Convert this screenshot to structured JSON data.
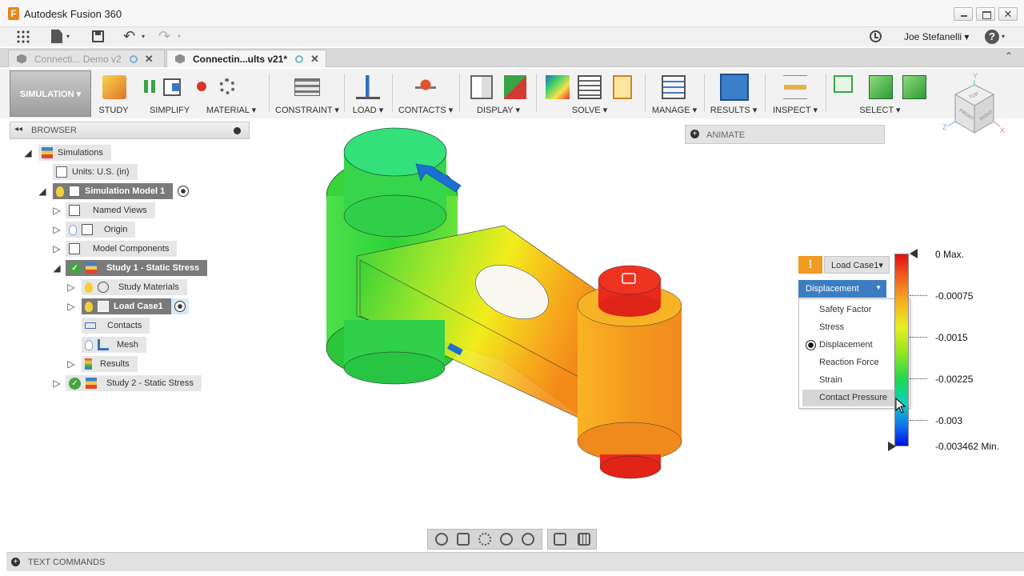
{
  "window": {
    "app_title": "Autodesk Fusion 360",
    "logo_letter": "F",
    "close_glyph": "✕"
  },
  "quick_access": {
    "user_name": "Joe Stefanelli ▾",
    "help_label": "?",
    "undo_glyph": "↶",
    "redo_glyph": "↷",
    "caret": "▾"
  },
  "tabs": [
    {
      "label": "Connecti... Demo v2",
      "active": false
    },
    {
      "label": "Connectin...ults v21*",
      "active": true
    }
  ],
  "tab_close_glyph": "✕",
  "tab_expand_glyph": "⌃",
  "ribbon": {
    "workspace": "SIMULATION ▾",
    "groups": [
      {
        "label": "STUDY"
      },
      {
        "label": "SIMPLIFY"
      },
      {
        "label": "MATERIAL ▾"
      },
      {
        "label": "CONSTRAINT ▾"
      },
      {
        "label": "LOAD ▾"
      },
      {
        "label": "CONTACTS ▾"
      },
      {
        "label": "DISPLAY ▾"
      },
      {
        "label": "SOLVE ▾"
      },
      {
        "label": "MANAGE ▾"
      },
      {
        "label": "RESULTS ▾"
      },
      {
        "label": "INSPECT ▾"
      },
      {
        "label": "SELECT ▾"
      }
    ]
  },
  "browser": {
    "title": "BROWSER",
    "collapse_glyph": "◂◂",
    "items": [
      {
        "label": "Simulations"
      },
      {
        "label": "Units: U.S. (in)"
      },
      {
        "label": "Simulation Model 1"
      },
      {
        "label": "Named Views"
      },
      {
        "label": "Origin"
      },
      {
        "label": "Model Components"
      },
      {
        "label": "Study 1 - Static Stress"
      },
      {
        "label": "Study Materials"
      },
      {
        "label": "Load Case1"
      },
      {
        "label": "Contacts"
      },
      {
        "label": "Mesh"
      },
      {
        "label": "Results"
      },
      {
        "label": "Study 2 - Static Stress"
      }
    ],
    "check_glyph": "✓",
    "expand_glyph": "▷",
    "expanded_glyph": "◢"
  },
  "animate": {
    "label": "ANIMATE",
    "plus_glyph": "+"
  },
  "legend": {
    "warning_glyph": "!",
    "load_case": "Load Case1▾",
    "result_type": "Displacement",
    "result_caret": "▼",
    "options": [
      "Safety Factor",
      "Stress",
      "Displacement",
      "Reaction Force",
      "Strain",
      "Contact Pressure"
    ],
    "selected_option": "Displacement",
    "hovered_option": "Contact Pressure",
    "ticks": [
      "0 Max.",
      "-0.00075",
      "-0.0015",
      "-0.00225",
      "-0.003",
      "-0.003462 Min."
    ],
    "max_color": "#e01010",
    "min_color": "#0010e0"
  },
  "viewcube": {
    "top": "TOP",
    "front": "FRONT",
    "right": "RIGHT",
    "x": "X",
    "y": "Y",
    "z": "Z"
  },
  "text_commands": {
    "label": "TEXT COMMANDS",
    "plus_glyph": "+"
  },
  "colors": {
    "accent": "#3c7dc1",
    "warning": "#f39a22",
    "ok": "#44a540"
  }
}
